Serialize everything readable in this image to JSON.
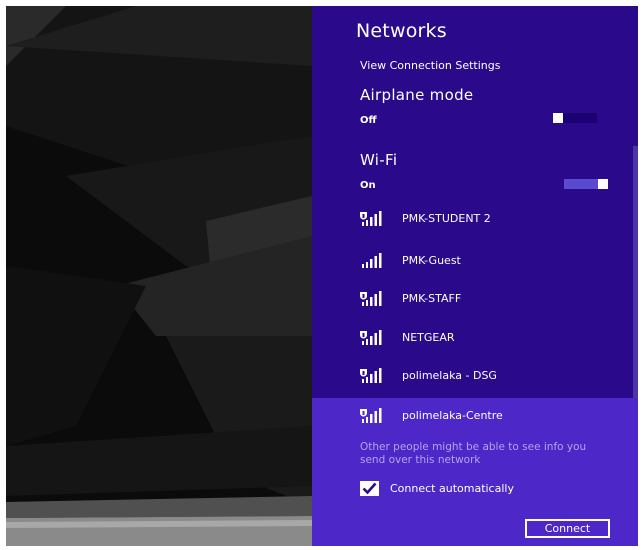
{
  "panel": {
    "title": "Networks",
    "view_settings_link": "View Connection Settings"
  },
  "airplane_mode": {
    "label": "Airplane mode",
    "state": "Off",
    "enabled": false
  },
  "wifi": {
    "label": "Wi-Fi",
    "state": "On",
    "enabled": true
  },
  "networks": [
    {
      "name": "PMK-STUDENT 2",
      "secured": true,
      "signal": 4
    },
    {
      "name": "PMK-Guest",
      "secured": false,
      "signal": 4
    },
    {
      "name": "PMK-STAFF",
      "secured": true,
      "signal": 4
    },
    {
      "name": "NETGEAR",
      "secured": true,
      "signal": 4
    },
    {
      "name": "polimelaka - DSG",
      "secured": true,
      "signal": 4
    }
  ],
  "selected_network": {
    "name": "polimelaka-Centre",
    "secured": true,
    "signal": 4,
    "warning": "Other people might be able to see info you send over this network",
    "connect_automatically_label": "Connect automatically",
    "connect_automatically": true,
    "connect_button": "Connect"
  },
  "colors": {
    "panel_bg": "#2a0a8a",
    "selected_bg": "#4d27c8",
    "warning_text": "#b3a4ee",
    "desktop_bg": "#0a0a0a"
  }
}
